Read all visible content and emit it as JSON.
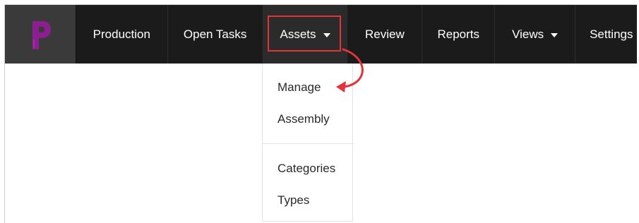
{
  "navbar": {
    "logo_icon": "p-logo-icon",
    "items": [
      {
        "label": "Production",
        "has_caret": false
      },
      {
        "label": "Open Tasks",
        "has_caret": false
      },
      {
        "label": "Assets",
        "has_caret": true,
        "active": true
      },
      {
        "label": "Review",
        "has_caret": false
      },
      {
        "label": "Reports",
        "has_caret": false
      },
      {
        "label": "Views",
        "has_caret": true
      },
      {
        "label": "Settings",
        "has_caret": false
      }
    ]
  },
  "dropdown": {
    "items": [
      "Manage",
      "Assembly",
      "Categories",
      "Types"
    ]
  },
  "colors": {
    "navbar_bg": "#1b1b1b",
    "logo_cell_bg": "#3a3a3a",
    "logo_purple": "#8c1f8f",
    "annotation_red": "#e0333a"
  }
}
